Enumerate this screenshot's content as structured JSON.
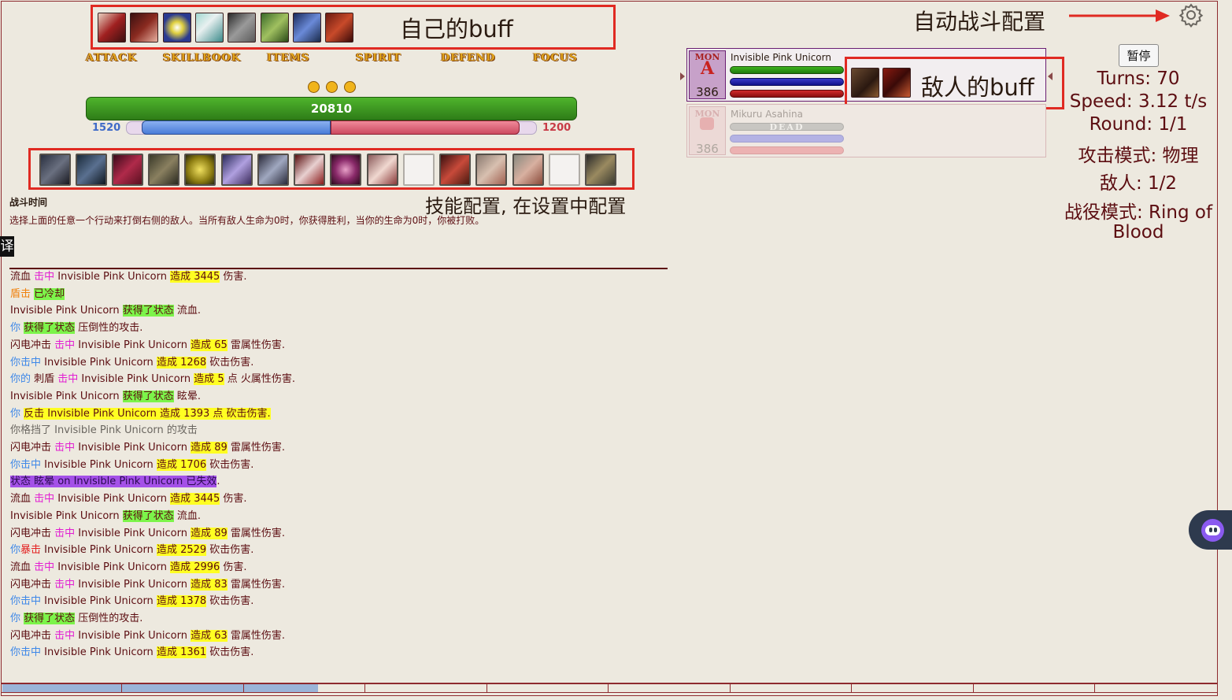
{
  "annotations": {
    "self_buff": "自己的buff",
    "auto_battle": "自动战斗配置",
    "enemy_buff": "敌人的buff",
    "skill_config": "技能配置, 在设置中配置"
  },
  "buff_icons": [
    "buff-icon-1",
    "buff-icon-2",
    "buff-icon-3",
    "buff-icon-4",
    "buff-icon-5",
    "buff-icon-6",
    "buff-icon-7",
    "buff-icon-8"
  ],
  "menu": [
    "ATTACK",
    "SKILLBOOK",
    "ITEMS",
    "SPIRIT",
    "DEFEND",
    "FOCUS"
  ],
  "player": {
    "hp": "20810",
    "mp": "1520",
    "sp": "1200",
    "mp_fraction": 0.5,
    "sp_fraction": 0.5
  },
  "battle_time_title": "战斗时间",
  "battle_instructions": "选择上面的任意一个行动来打倒右侧的敌人。当所有敌人生命为0时，你获得胜利，当你的生命为0时，你被打败。",
  "translate_badge": "译",
  "monsters": [
    {
      "tag": "MON",
      "letter": "A",
      "name": "Invisible Pink Unicorn",
      "level": "386",
      "dead_label": ""
    },
    {
      "tag": "MON",
      "letter": "",
      "name": "Mikuru Asahina",
      "level": "386",
      "dead_label": "DEAD"
    }
  ],
  "pause_button": "暂停",
  "stats": {
    "turns": "Turns: 70",
    "speed": "Speed: 3.12 t/s",
    "round": "Round: 1/1",
    "attack_mode": "攻击模式: 物理",
    "enemies": "敌人: 1/2",
    "campaign_line1": "战役模式: Ring of",
    "campaign_line2": "Blood"
  },
  "log": [
    [
      [
        "流血 ",
        ""
      ],
      [
        "击中",
        "c-mag"
      ],
      [
        " Invisible Pink Unicorn ",
        ""
      ],
      [
        "造成 3445",
        "hl-y"
      ],
      [
        " 伤害.",
        ""
      ]
    ],
    [
      [
        "盾击 ",
        "c-orange"
      ],
      [
        "已冷却",
        "hl-g"
      ]
    ],
    [
      [
        "Invisible Pink Unicorn ",
        ""
      ],
      [
        "获得了状态",
        "hl-g"
      ],
      [
        " 流血.",
        ""
      ]
    ],
    [
      [
        "你 ",
        "c-blue"
      ],
      [
        "获得了状态",
        "hl-g"
      ],
      [
        " 压倒性的攻击.",
        ""
      ]
    ],
    [
      [
        "闪电冲击 ",
        ""
      ],
      [
        "击中",
        "c-mag"
      ],
      [
        " Invisible Pink Unicorn ",
        ""
      ],
      [
        "造成 65",
        "hl-y"
      ],
      [
        " 雷属性伤害.",
        ""
      ]
    ],
    [
      [
        "你击中",
        "c-blue"
      ],
      [
        " Invisible Pink Unicorn ",
        ""
      ],
      [
        "造成 1268",
        "hl-y"
      ],
      [
        " 砍击伤害.",
        ""
      ]
    ],
    [
      [
        "你的",
        "c-blue"
      ],
      [
        " 刺盾 ",
        ""
      ],
      [
        "击中",
        "c-mag"
      ],
      [
        " Invisible Pink Unicorn ",
        ""
      ],
      [
        "造成 5",
        "hl-y"
      ],
      [
        " 点 火属性伤害.",
        ""
      ]
    ],
    [
      [
        "Invisible Pink Unicorn ",
        ""
      ],
      [
        "获得了状态",
        "hl-g"
      ],
      [
        " 眩晕.",
        ""
      ]
    ],
    [
      [
        "你 ",
        "c-blue"
      ],
      [
        "反击 Invisible Pink Unicorn 造成 1393 点 砍击伤害.",
        "hl-y"
      ]
    ],
    [
      [
        "你格挡了 Invisible Pink Unicorn 的攻击",
        "c-grey"
      ]
    ],
    [
      [
        "闪电冲击 ",
        ""
      ],
      [
        "击中",
        "c-mag"
      ],
      [
        " Invisible Pink Unicorn ",
        ""
      ],
      [
        "造成 89",
        "hl-y"
      ],
      [
        " 雷属性伤害.",
        ""
      ]
    ],
    [
      [
        "你击中",
        "c-blue"
      ],
      [
        " Invisible Pink Unicorn ",
        ""
      ],
      [
        "造成 1706",
        "hl-y"
      ],
      [
        " 砍击伤害.",
        ""
      ]
    ],
    [
      [
        "状态 眩晕 on Invisible Pink Unicorn 已失效",
        "hl-purple"
      ],
      [
        ".",
        ""
      ]
    ],
    [
      [
        "流血 ",
        ""
      ],
      [
        "击中",
        "c-mag"
      ],
      [
        " Invisible Pink Unicorn ",
        ""
      ],
      [
        "造成 3445",
        "hl-y"
      ],
      [
        " 伤害.",
        ""
      ]
    ],
    [
      [
        "Invisible Pink Unicorn ",
        ""
      ],
      [
        "获得了状态",
        "hl-g"
      ],
      [
        " 流血.",
        ""
      ]
    ],
    [
      [
        "闪电冲击 ",
        ""
      ],
      [
        "击中",
        "c-mag"
      ],
      [
        " Invisible Pink Unicorn ",
        ""
      ],
      [
        "造成 89",
        "hl-y"
      ],
      [
        " 雷属性伤害.",
        ""
      ]
    ],
    [
      [
        "你",
        "c-blue"
      ],
      [
        "暴击",
        "c-red"
      ],
      [
        " Invisible Pink Unicorn ",
        ""
      ],
      [
        "造成 2529",
        "hl-y"
      ],
      [
        " 砍击伤害.",
        ""
      ]
    ],
    [
      [
        "流血 ",
        ""
      ],
      [
        "击中",
        "c-mag"
      ],
      [
        " Invisible Pink Unicorn ",
        ""
      ],
      [
        "造成 2996",
        "hl-y"
      ],
      [
        " 伤害.",
        ""
      ]
    ],
    [
      [
        "闪电冲击 ",
        ""
      ],
      [
        "击中",
        "c-mag"
      ],
      [
        " Invisible Pink Unicorn ",
        ""
      ],
      [
        "造成 83",
        "hl-y"
      ],
      [
        " 雷属性伤害.",
        ""
      ]
    ],
    [
      [
        "你击中",
        "c-blue"
      ],
      [
        " Invisible Pink Unicorn ",
        ""
      ],
      [
        "造成 1378",
        "hl-y"
      ],
      [
        " 砍击伤害.",
        ""
      ]
    ],
    [
      [
        "你 ",
        "c-blue"
      ],
      [
        "获得了状态",
        "hl-g"
      ],
      [
        " 压倒性的攻击.",
        ""
      ]
    ],
    [
      [
        "闪电冲击 ",
        ""
      ],
      [
        "击中",
        "c-mag"
      ],
      [
        " Invisible Pink Unicorn ",
        ""
      ],
      [
        "造成 63",
        "hl-y"
      ],
      [
        " 雷属性伤害.",
        ""
      ]
    ],
    [
      [
        "你击中",
        "c-blue"
      ],
      [
        " Invisible Pink Unicorn ",
        ""
      ],
      [
        "造成 1361",
        "hl-y"
      ],
      [
        " 砍击伤害.",
        ""
      ]
    ]
  ],
  "icons": {
    "settings": "gear-icon",
    "arrow": "arrow-right-icon",
    "assistant": "assistant-bubble-icon"
  },
  "colors": {
    "hp": "#3c9a1e",
    "mp": "#5b8ee0",
    "sp": "#e0667a",
    "annotation": "#e02a22"
  }
}
